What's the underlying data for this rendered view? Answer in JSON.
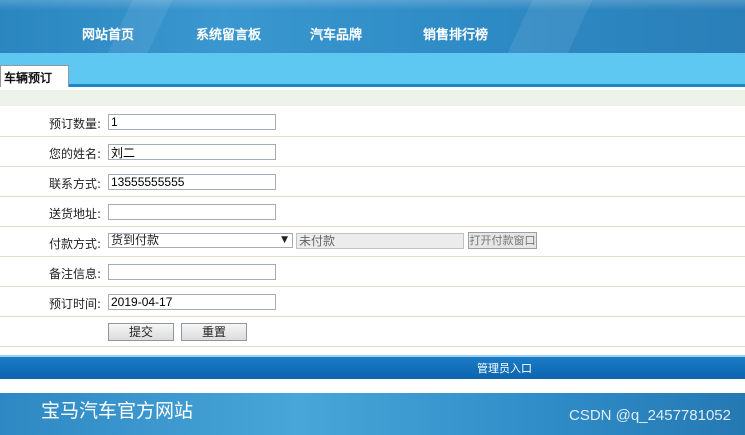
{
  "nav": {
    "items": [
      {
        "label": "网站首页"
      },
      {
        "label": "系统留言板"
      },
      {
        "label": "汽车品牌"
      },
      {
        "label": "销售排行榜"
      }
    ]
  },
  "tab": {
    "label": "车辆预订"
  },
  "form": {
    "quantity": {
      "label": "预订数量:",
      "value": "1"
    },
    "name": {
      "label": "您的姓名:",
      "value": "刘二"
    },
    "phone": {
      "label": "联系方式:",
      "value": "13555555555"
    },
    "address": {
      "label": "送货地址:",
      "value": ""
    },
    "payment": {
      "label": "付款方式:",
      "selected": "货到付款",
      "status": "未付款",
      "open_window_label": "打开付款窗口"
    },
    "notes": {
      "label": "备注信息:",
      "value": ""
    },
    "order_time": {
      "label": "预订时间:",
      "value": "2019-04-17"
    },
    "submit_label": "提交",
    "reset_label": "重置"
  },
  "admin": {
    "link_label": "管理员入口"
  },
  "footer": {
    "site_title": "宝马汽车官方网站",
    "watermark": "CSDN @q_2457781052"
  },
  "icons": {
    "select_arrow": "chevron-down-icon"
  }
}
